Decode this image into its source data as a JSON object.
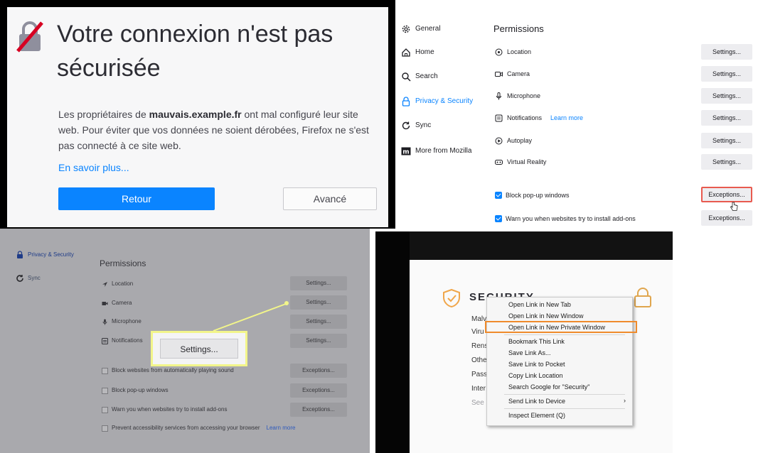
{
  "panel1": {
    "title_line1": "Votre connexion n'est pas",
    "title_line2": "sécurisée",
    "msg_part1": "Les propriétaires de ",
    "msg_domain": "mauvais.example.fr",
    "msg_part2": " ont mal configuré leur site web. Pour éviter que vos données ne soient dérobées, Firefox ne s'est pas connecté à ce site web.",
    "learn_more": "En savoir plus...",
    "back_button": "Retour",
    "advanced_button": "Avancé",
    "icon": "broken-lock-icon",
    "accent_color": "#0a84ff"
  },
  "panel2": {
    "nav": [
      {
        "label": "General",
        "icon": "gear-icon"
      },
      {
        "label": "Home",
        "icon": "home-icon"
      },
      {
        "label": "Search",
        "icon": "search-icon"
      },
      {
        "label": "Privacy & Security",
        "icon": "lock-icon",
        "active": true
      },
      {
        "label": "Sync",
        "icon": "sync-icon"
      },
      {
        "label": "More from Mozilla",
        "icon": "mozilla-icon"
      }
    ],
    "heading": "Permissions",
    "permissions": [
      {
        "label": "Location",
        "icon": "location-icon",
        "button": "Settings..."
      },
      {
        "label": "Camera",
        "icon": "camera-icon",
        "button": "Settings..."
      },
      {
        "label": "Microphone",
        "icon": "microphone-icon",
        "button": "Settings..."
      },
      {
        "label": "Notifications",
        "icon": "notifications-icon",
        "link": "Learn more",
        "button": "Settings..."
      },
      {
        "label": "Autoplay",
        "icon": "autoplay-icon",
        "button": "Settings..."
      },
      {
        "label": "Virtual Reality",
        "icon": "vr-icon",
        "button": "Settings..."
      }
    ],
    "checkboxes": [
      {
        "label": "Block pop-up windows",
        "checked": true,
        "button": "Exceptions..."
      },
      {
        "label": "Warn you when websites try to install add-ons",
        "checked": true,
        "button": "Exceptions..."
      }
    ],
    "highlight_color": "#e85a4f"
  },
  "panel3": {
    "nav": [
      {
        "label": "Privacy & Security",
        "icon": "lock-icon",
        "active": true
      },
      {
        "label": "Sync",
        "icon": "sync-icon"
      }
    ],
    "heading": "Permissions",
    "permissions": [
      {
        "label": "Location",
        "icon": "location-icon",
        "button": "Settings..."
      },
      {
        "label": "Camera",
        "icon": "camera-icon",
        "button": "Settings..."
      },
      {
        "label": "Microphone",
        "icon": "microphone-icon",
        "button": "Settings..."
      },
      {
        "label": "Notifications",
        "icon": "notifications-icon",
        "button": "Settings..."
      }
    ],
    "checkboxes": [
      {
        "label": "Block websites from automatically playing sound",
        "button": "Exceptions..."
      },
      {
        "label": "Block pop-up windows",
        "button": "Exceptions..."
      },
      {
        "label": "Warn you when websites try to install add-ons",
        "button": "Exceptions..."
      },
      {
        "label": "Prevent accessibility services from accessing your browser",
        "link": "Learn more"
      }
    ],
    "zoom_button": "Settings...",
    "callout_color": "#f2f58a"
  },
  "panel4": {
    "section_title": "SECURITY",
    "truncated_items": [
      "Malv",
      "Viru",
      "Rens",
      "Othe",
      "Pass",
      "Inter",
      "See"
    ],
    "menu": [
      {
        "label": "Open Link in New Tab"
      },
      {
        "label": "Open Link in New Window"
      },
      {
        "label": "Open Link in New Private Window",
        "highlighted": true
      },
      {
        "separator": true
      },
      {
        "label": "Bookmark This Link"
      },
      {
        "label": "Save Link As..."
      },
      {
        "label": "Save Link to Pocket"
      },
      {
        "label": "Copy Link Location"
      },
      {
        "label": "Search Google for \"Security\""
      },
      {
        "separator": true
      },
      {
        "label": "Send Link to Device",
        "submenu": true
      },
      {
        "separator": true
      },
      {
        "label": "Inspect Element (Q)"
      }
    ],
    "submenu_arrow": "›",
    "highlight_color": "#ef8b2c"
  }
}
